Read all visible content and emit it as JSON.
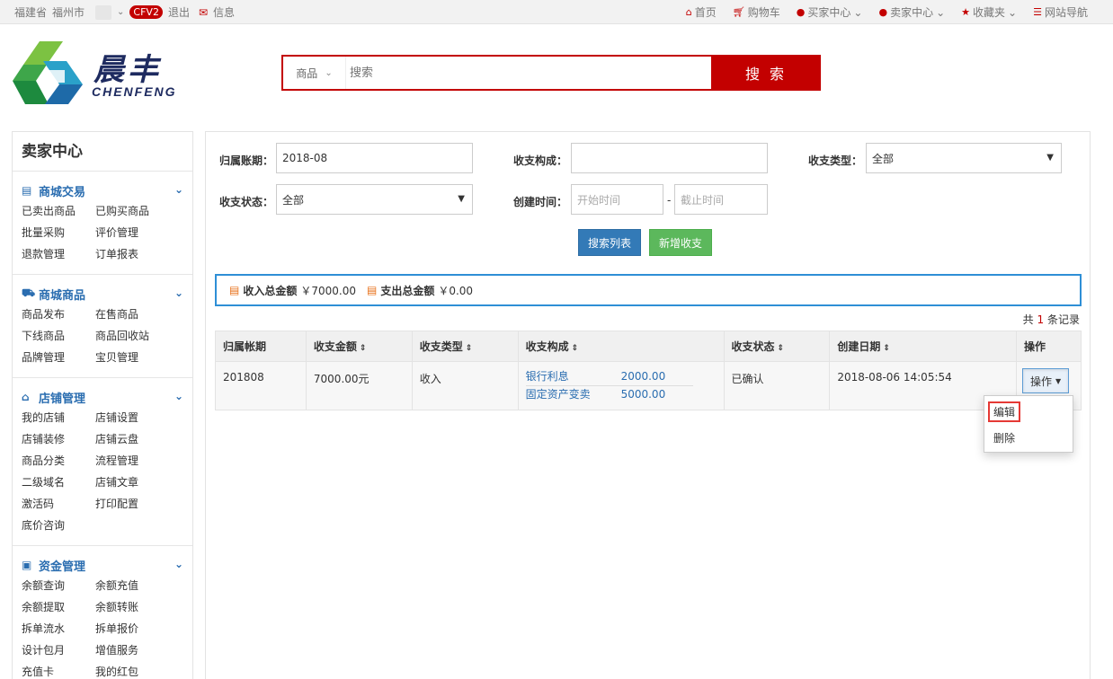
{
  "topbar": {
    "province": "福建省",
    "city": "福州市",
    "user_badge": "CFV2",
    "logout": "退出",
    "messages": "信息",
    "links": [
      {
        "label": "首页",
        "icon": "home-icon"
      },
      {
        "label": "购物车",
        "icon": "cart-icon"
      },
      {
        "label": "买家中心",
        "icon": "user-icon"
      },
      {
        "label": "卖家中心",
        "icon": "user-icon"
      },
      {
        "label": "收藏夹",
        "icon": "star-icon"
      },
      {
        "label": "网站导航",
        "icon": "list-icon"
      }
    ]
  },
  "logo": {
    "cn": "晨丰",
    "en": "CHENFENG"
  },
  "search": {
    "category": "商品",
    "placeholder": "搜索",
    "button": "搜 索"
  },
  "sidebar": {
    "title": "卖家中心",
    "groups": [
      {
        "title": "商城交易",
        "icon": "card-icon",
        "items": [
          "已卖出商品",
          "已购买商品",
          "批量采购",
          "评价管理",
          "退款管理",
          "订单报表"
        ]
      },
      {
        "title": "商城商品",
        "icon": "truck-icon",
        "items": [
          "商品发布",
          "在售商品",
          "下线商品",
          "商品回收站",
          "品牌管理",
          "宝贝管理"
        ]
      },
      {
        "title": "店铺管理",
        "icon": "home-icon",
        "items": [
          "我的店铺",
          "店铺设置",
          "店铺装修",
          "店铺云盘",
          "商品分类",
          "流程管理",
          "二级域名",
          "店铺文章",
          "激活码",
          "打印配置",
          "底价咨询"
        ]
      },
      {
        "title": "资金管理",
        "icon": "money-icon",
        "items": [
          "余额查询",
          "余额充值",
          "余额提取",
          "余额转账",
          "拆单流水",
          "拆单报价",
          "设计包月",
          "增值服务",
          "充值卡",
          "我的红包"
        ]
      }
    ]
  },
  "filters": {
    "period_label": "归属账期：",
    "period_value": "2018-08",
    "composition_label": "收支构成：",
    "composition_value": "",
    "type_label": "收支类型：",
    "type_value": "全部",
    "status_label": "收支状态：",
    "status_value": "全部",
    "created_label": "创建时间：",
    "start_placeholder": "开始时间",
    "end_placeholder": "截止时间",
    "dash": "-",
    "search_button": "搜索列表",
    "add_button": "新增收支"
  },
  "summary": {
    "income_label": "收入总金额",
    "income_value": "￥7000.00",
    "expense_label": "支出总金额",
    "expense_value": "￥0.00"
  },
  "records": {
    "prefix": "共",
    "count": "1",
    "suffix": "条记录"
  },
  "table": {
    "headers": [
      "归属帐期",
      "收支金额",
      "收支类型",
      "收支构成",
      "收支状态",
      "创建日期",
      "操作"
    ],
    "rows": [
      {
        "period": "201808",
        "amount": "7000.00元",
        "type": "收入",
        "composition": [
          {
            "name": "银行利息",
            "value": "2000.00"
          },
          {
            "name": "固定资产变卖",
            "value": "5000.00"
          }
        ],
        "status": "已确认",
        "created": "2018-08-06 14:05:54",
        "action": "操作"
      }
    ]
  },
  "dropdown": {
    "edit": "编辑",
    "delete": "删除"
  }
}
